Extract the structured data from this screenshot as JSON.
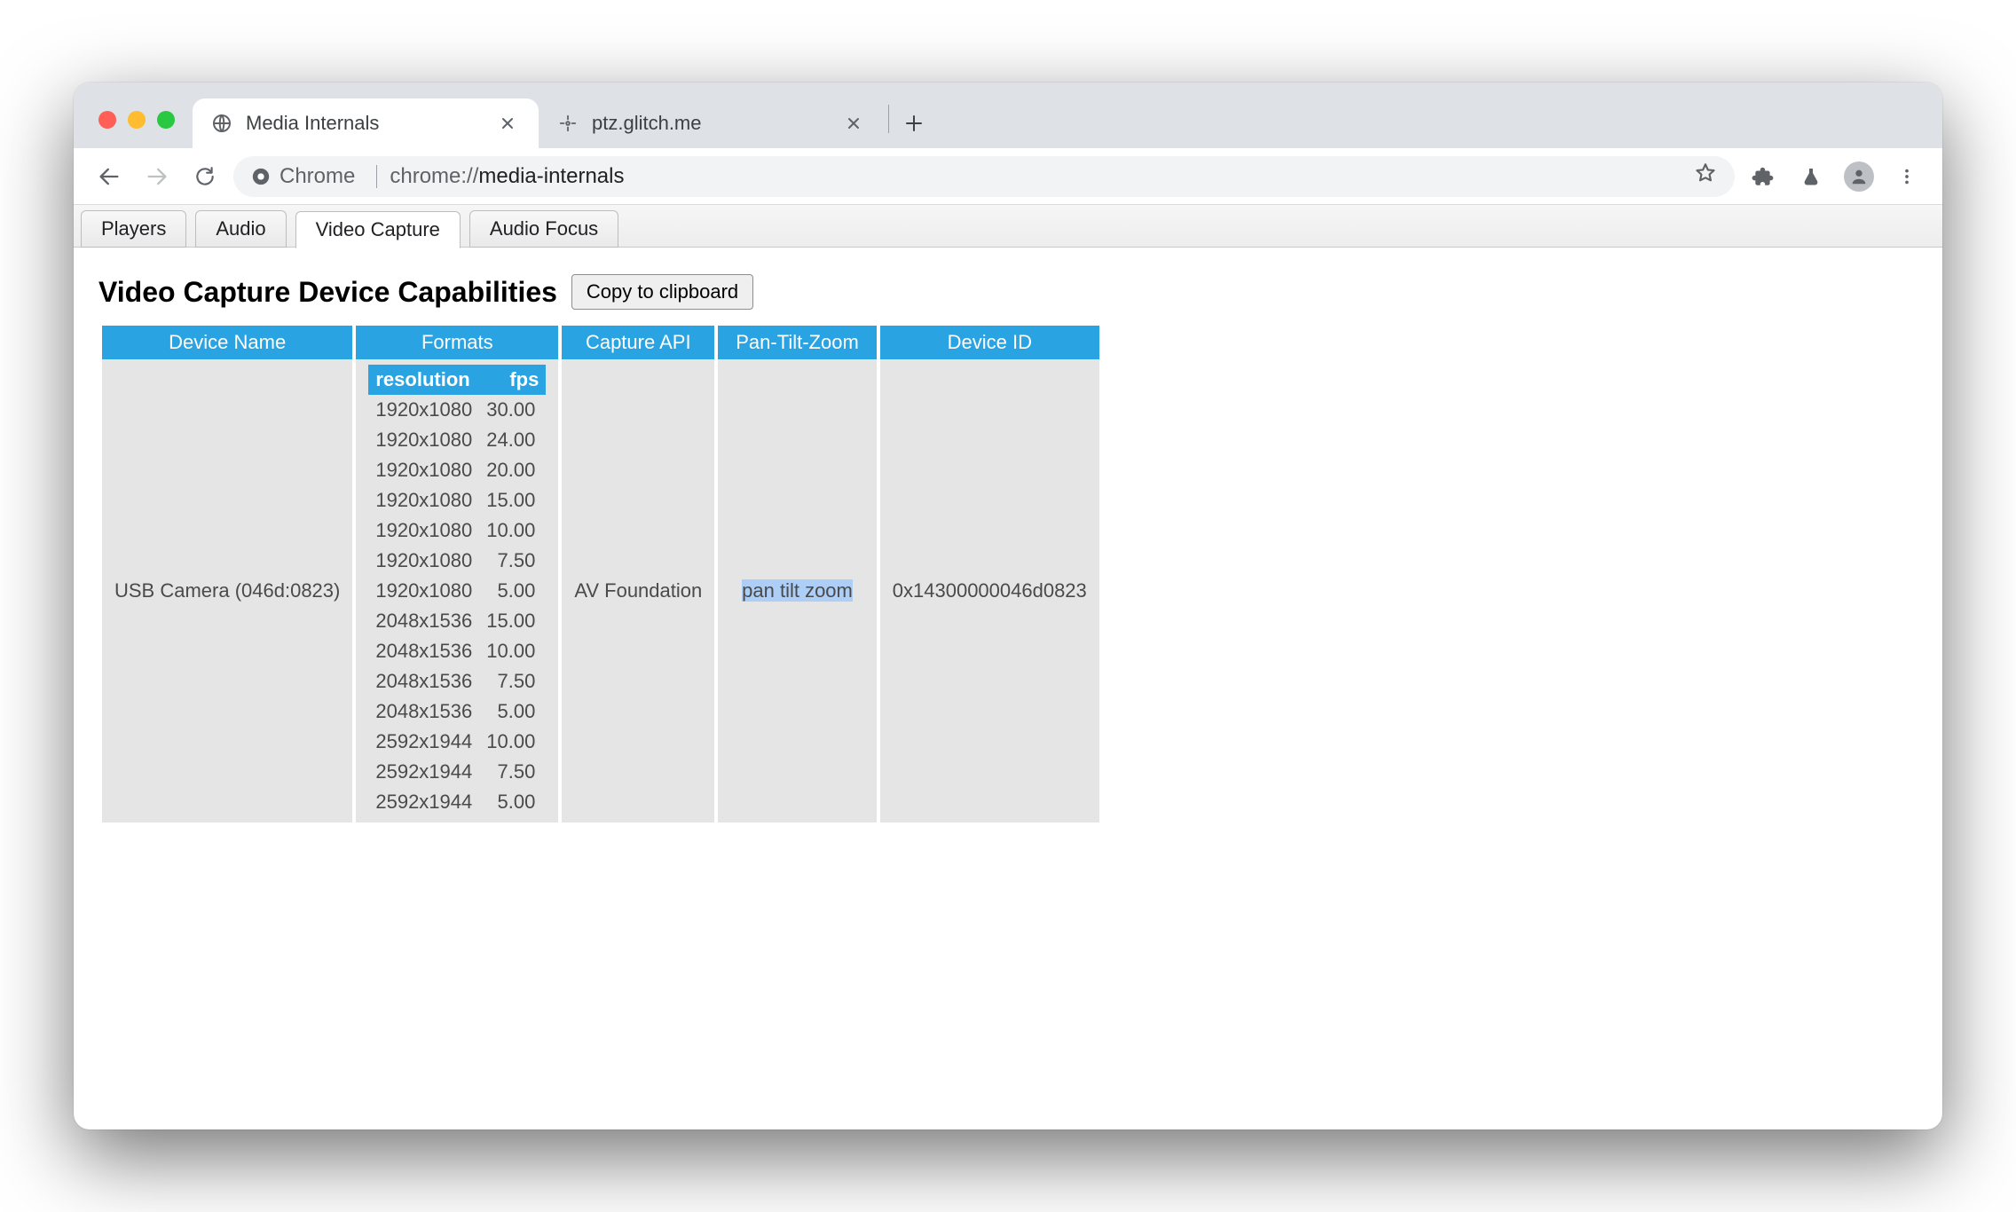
{
  "browser_tabs": [
    {
      "title": "Media Internals",
      "active": true
    },
    {
      "title": "ptz.glitch.me",
      "active": false
    }
  ],
  "omnibox": {
    "origin_label": "Chrome",
    "url_scheme": "chrome://",
    "url_path": "media-internals"
  },
  "subtabs": {
    "items": [
      "Players",
      "Audio",
      "Video Capture",
      "Audio Focus"
    ],
    "active_index": 2
  },
  "page": {
    "heading": "Video Capture Device Capabilities",
    "copy_button": "Copy to clipboard",
    "table": {
      "columns": [
        "Device Name",
        "Formats",
        "Capture API",
        "Pan-Tilt-Zoom",
        "Device ID"
      ],
      "fmt_cols": {
        "res": "resolution",
        "fps": "fps"
      },
      "rows": [
        {
          "device_name": "USB Camera (046d:0823)",
          "capture_api": "AV Foundation",
          "ptz": "pan tilt zoom",
          "device_id": "0x14300000046d0823",
          "formats": [
            {
              "res": "1920x1080",
              "fps": "30.00"
            },
            {
              "res": "1920x1080",
              "fps": "24.00"
            },
            {
              "res": "1920x1080",
              "fps": "20.00"
            },
            {
              "res": "1920x1080",
              "fps": "15.00"
            },
            {
              "res": "1920x1080",
              "fps": "10.00"
            },
            {
              "res": "1920x1080",
              "fps": "7.50"
            },
            {
              "res": "1920x1080",
              "fps": "5.00"
            },
            {
              "res": "2048x1536",
              "fps": "15.00"
            },
            {
              "res": "2048x1536",
              "fps": "10.00"
            },
            {
              "res": "2048x1536",
              "fps": "7.50"
            },
            {
              "res": "2048x1536",
              "fps": "5.00"
            },
            {
              "res": "2592x1944",
              "fps": "10.00"
            },
            {
              "res": "2592x1944",
              "fps": "7.50"
            },
            {
              "res": "2592x1944",
              "fps": "5.00"
            }
          ]
        }
      ]
    }
  }
}
